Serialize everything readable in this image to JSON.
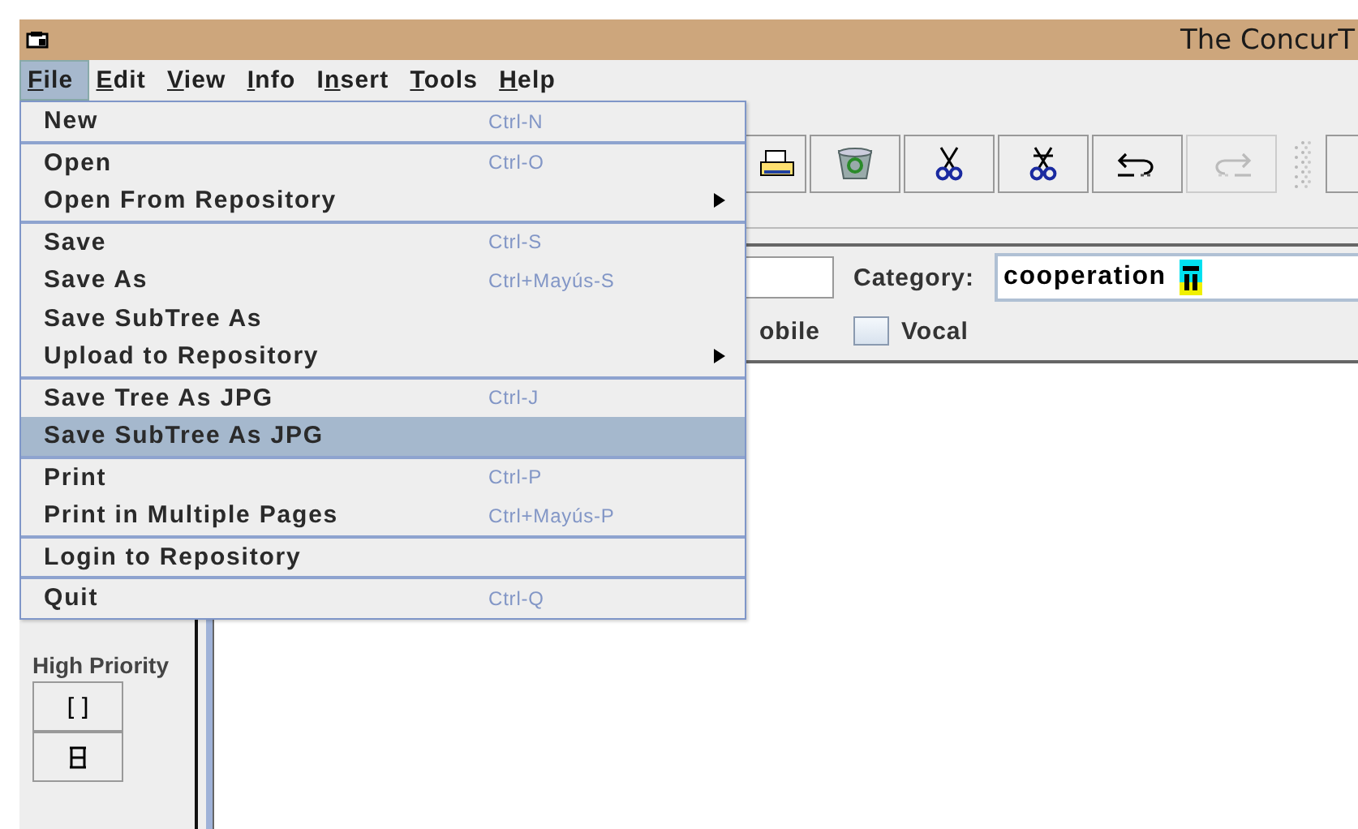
{
  "window": {
    "title": "The ConcurT"
  },
  "menubar": [
    {
      "key": "F",
      "rest": "ile",
      "selected": true
    },
    {
      "key": "E",
      "rest": "dit",
      "selected": false
    },
    {
      "key": "V",
      "rest": "iew",
      "selected": false
    },
    {
      "key": "I",
      "rest": "nfo",
      "selected": false
    },
    {
      "lead": "I",
      "key": "n",
      "rest": "sert",
      "selected": false
    },
    {
      "key": "T",
      "rest": "ools",
      "selected": false
    },
    {
      "key": "H",
      "rest": "elp",
      "selected": false
    }
  ],
  "file_menu": [
    {
      "kind": "item",
      "label": "New",
      "shortcut": "Ctrl-N",
      "submenu": false,
      "selected": false
    },
    {
      "kind": "separator"
    },
    {
      "kind": "item",
      "label": "Open",
      "shortcut": "Ctrl-O",
      "submenu": false,
      "selected": false
    },
    {
      "kind": "item",
      "label": "Open From Repository",
      "submenu": true,
      "selected": false
    },
    {
      "kind": "separator"
    },
    {
      "kind": "item",
      "label": "Save",
      "shortcut": "Ctrl-S",
      "submenu": false,
      "selected": false
    },
    {
      "kind": "item",
      "label": "Save As",
      "shortcut": "Ctrl+Mayús-S",
      "submenu": false,
      "selected": false
    },
    {
      "kind": "item",
      "label": "Save SubTree As",
      "submenu": false,
      "selected": false
    },
    {
      "kind": "item",
      "label": "Upload to Repository",
      "submenu": true,
      "selected": false
    },
    {
      "kind": "separator"
    },
    {
      "kind": "item",
      "label": "Save Tree As JPG",
      "shortcut": "Ctrl-J",
      "submenu": false,
      "selected": false
    },
    {
      "kind": "item",
      "label": "Save SubTree As JPG",
      "submenu": false,
      "selected": true
    },
    {
      "kind": "separator"
    },
    {
      "kind": "item",
      "label": "Print",
      "shortcut": "Ctrl-P",
      "submenu": false,
      "selected": false
    },
    {
      "kind": "item",
      "label": "Print in Multiple Pages",
      "shortcut": "Ctrl+Mayús-P",
      "submenu": false,
      "selected": false
    },
    {
      "kind": "separator"
    },
    {
      "kind": "item",
      "label": "Login to Repository",
      "submenu": false,
      "selected": false
    },
    {
      "kind": "separator"
    },
    {
      "kind": "item",
      "label": "Quit",
      "shortcut": "Ctrl-Q",
      "submenu": false,
      "selected": false
    }
  ],
  "toolbar": [
    {
      "kind": "printer",
      "disabled": false
    },
    {
      "kind": "recycle",
      "disabled": false
    },
    {
      "kind": "scissors",
      "disabled": false
    },
    {
      "kind": "scissors-bar",
      "disabled": false
    },
    {
      "kind": "undo",
      "disabled": false
    },
    {
      "kind": "redo",
      "disabled": true
    },
    {
      "kind": "grip"
    },
    {
      "kind": "blank",
      "disabled": false
    }
  ],
  "form": {
    "category_label": "Category:",
    "category_value": "cooperation",
    "partial_label": "obile",
    "vocal": {
      "label": "Vocal",
      "checked": false
    }
  },
  "left_panel": {
    "label": "High Priority",
    "buttons": [
      "[]"
    ]
  }
}
